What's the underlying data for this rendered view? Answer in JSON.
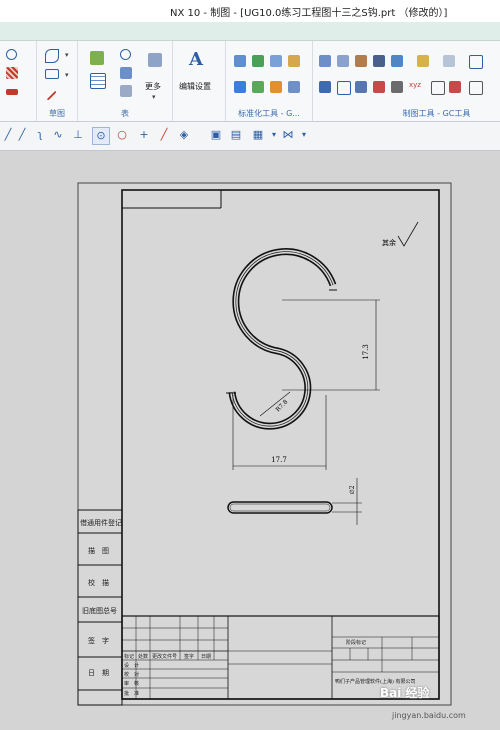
{
  "window": {
    "title": "NX 10 - 制图 - [UG10.0练习工程图十三之S钩.prt （修改的）]"
  },
  "ribbon": {
    "groups": [
      {
        "label": "草图"
      },
      {
        "label": "表"
      },
      {
        "label": "标准化工具 - G..."
      },
      {
        "label": "制图工具 - GC工具"
      }
    ],
    "more_label": "更多",
    "edit_settings_label": "编辑设置"
  },
  "drawing": {
    "annotations": {
      "roughness_text": "其余",
      "dim_height": "17.3",
      "dim_width": "17.7",
      "dim_radius": "R7.8",
      "dim_diameter": "∅2"
    },
    "side_blocks": [
      "借通用件登记",
      "描　图",
      "校　描",
      "旧底图总号",
      "签　字",
      "日　期"
    ],
    "title_block": {
      "row_headers": [
        "标记",
        "处数",
        "更改文件号",
        "签字",
        "日期"
      ],
      "row_labels": [
        "设　计",
        "校　对",
        "审　核",
        "批　准"
      ],
      "stage_label": "阶段标记",
      "company": "鸭们子产品管理软件(上海) 有限公司"
    }
  },
  "watermark": {
    "brand": "Bai 经验",
    "url": "jingyan.baidu.com"
  },
  "colors": {
    "accent": "#3a6bb0",
    "canvas": "#d4d4d4"
  }
}
